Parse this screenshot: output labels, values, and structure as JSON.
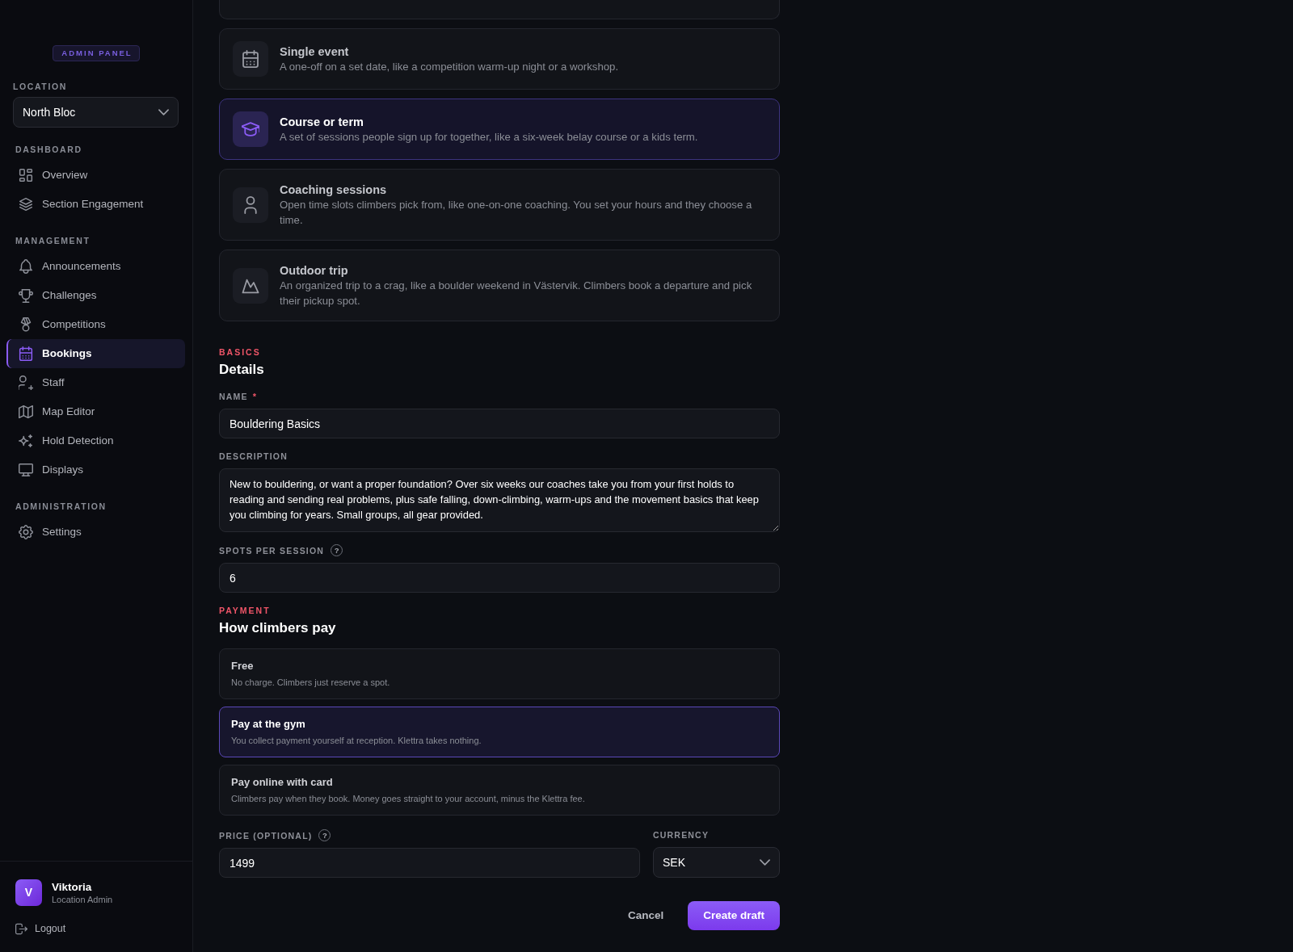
{
  "sidebar": {
    "badge": "ADMIN PANEL",
    "location": {
      "label": "LOCATION",
      "value": "North Bloc"
    },
    "sections": [
      {
        "title": "DASHBOARD",
        "items": [
          {
            "label": "Overview",
            "selected": false
          },
          {
            "label": "Section Engagement",
            "selected": false
          }
        ]
      },
      {
        "title": "MANAGEMENT",
        "items": [
          {
            "label": "Announcements",
            "selected": false
          },
          {
            "label": "Challenges",
            "selected": false
          },
          {
            "label": "Competitions",
            "selected": false
          },
          {
            "label": "Bookings",
            "selected": true
          },
          {
            "label": "Staff",
            "selected": false
          },
          {
            "label": "Map Editor",
            "selected": false
          },
          {
            "label": "Hold Detection",
            "selected": false
          },
          {
            "label": "Displays",
            "selected": false
          }
        ]
      },
      {
        "title": "ADMINISTRATION",
        "items": [
          {
            "label": "Settings",
            "selected": false
          }
        ]
      }
    ],
    "user": {
      "initial": "V",
      "name": "Viktoria",
      "role": "Location Admin"
    },
    "logout": "Logout"
  },
  "event_types": [
    {
      "title": "Single event",
      "description": "A one-off on a set date, like a competition warm-up night or a workshop.",
      "selected": false
    },
    {
      "title": "Course or term",
      "description": "A set of sessions people sign up for together, like a six-week belay course or a kids term.",
      "selected": true
    },
    {
      "title": "Coaching sessions",
      "description": "Open time slots climbers pick from, like one-on-one coaching. You set your hours and they choose a time.",
      "selected": false
    },
    {
      "title": "Outdoor trip",
      "description": "An organized trip to a crag, like a boulder weekend in Västervik. Climbers book a departure and pick their pickup spot.",
      "selected": false
    }
  ],
  "basics": {
    "eyebrow": "BASICS",
    "title": "Details",
    "fields": [
      {
        "kind": "text",
        "label": "NAME",
        "required_mark": "*",
        "value": "Bouldering Basics"
      },
      {
        "kind": "textarea",
        "label": "DESCRIPTION",
        "value": "New to bouldering, or want a proper foundation? Over six weeks our coaches take you from your first holds to reading and sending real problems, plus safe falling, down-climbing, warm-ups and the movement basics that keep you climbing for years. Small groups, all gear provided."
      },
      {
        "kind": "text",
        "label": "SPOTS PER SESSION",
        "help": "?",
        "value": "6"
      }
    ]
  },
  "payment": {
    "eyebrow": "PAYMENT",
    "title": "How climbers pay",
    "options": [
      {
        "title": "Free",
        "description": "No charge. Climbers just reserve a spot.",
        "selected": false
      },
      {
        "title": "Pay at the gym",
        "description": "You collect payment yourself at reception. Klettra takes nothing.",
        "selected": true
      },
      {
        "title": "Pay online with card",
        "description": "Climbers pay when they book. Money goes straight to your account, minus the Klettra fee.",
        "selected": false
      }
    ],
    "fields": [
      {
        "kind": "text",
        "label": "PRICE (OPTIONAL)",
        "help": "?",
        "value": "1499"
      },
      {
        "kind": "select",
        "label": "CURRENCY",
        "value": "SEK"
      }
    ]
  },
  "actions": {
    "cancel": "Cancel",
    "submit": "Create draft"
  }
}
